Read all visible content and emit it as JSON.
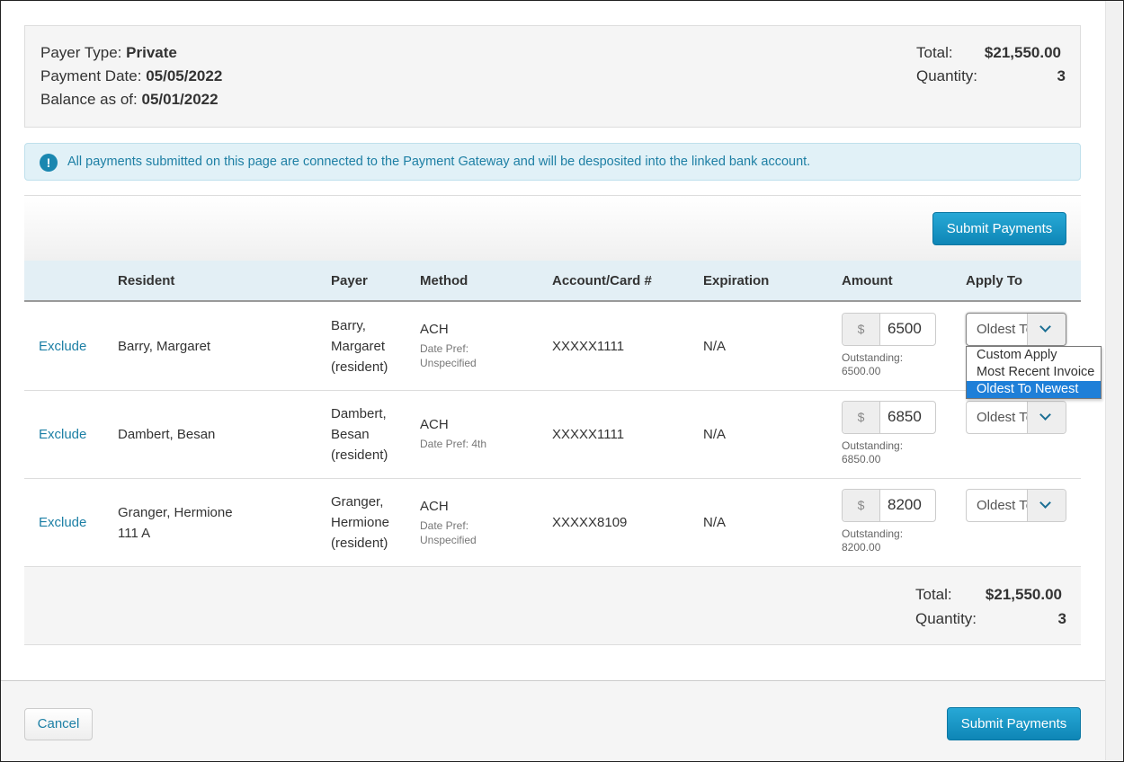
{
  "summary": {
    "payer_type_label": "Payer Type:",
    "payer_type": "Private",
    "payment_date_label": "Payment Date:",
    "payment_date": "05/05/2022",
    "balance_label": "Balance as of:",
    "balance_date": "05/01/2022",
    "total_label": "Total:",
    "total": "$21,550.00",
    "quantity_label": "Quantity:",
    "quantity": "3"
  },
  "alert": {
    "icon": "exclamation-icon",
    "message": "All payments submitted on this page are connected to the Payment Gateway and will be desposited into the linked bank account."
  },
  "toolbar": {
    "submit_label": "Submit Payments"
  },
  "table": {
    "headers": {
      "resident": "Resident",
      "payer": "Payer",
      "method": "Method",
      "account": "Account/Card #",
      "expiration": "Expiration",
      "amount": "Amount",
      "apply_to": "Apply To"
    },
    "rows": [
      {
        "exclude": "Exclude",
        "resident_name": "Barry, Margaret",
        "resident_room": "",
        "payer_line1": "Barry,",
        "payer_line2": "Margaret",
        "payer_line3": "(resident)",
        "method": "ACH",
        "date_pref_label": "Date Pref:",
        "date_pref": "Unspecified",
        "account": "XXXXX1111",
        "expiration": "N/A",
        "currency": "$",
        "amount": "6500",
        "outstanding_label": "Outstanding:",
        "outstanding": "6500.00",
        "apply_to": "Oldest To Newest"
      },
      {
        "exclude": "Exclude",
        "resident_name": "Dambert, Besan",
        "resident_room": "",
        "payer_line1": "Dambert,",
        "payer_line2": "Besan",
        "payer_line3": "(resident)",
        "method": "ACH",
        "date_pref_label": "Date Pref: 4th",
        "date_pref": "",
        "account": "XXXXX1111",
        "expiration": "N/A",
        "currency": "$",
        "amount": "6850",
        "outstanding_label": "Outstanding:",
        "outstanding": "6850.00",
        "apply_to": "Oldest To Newest"
      },
      {
        "exclude": "Exclude",
        "resident_name": "Granger, Hermione",
        "resident_room": "111 A",
        "payer_line1": "Granger,",
        "payer_line2": "Hermione",
        "payer_line3": "(resident)",
        "method": "ACH",
        "date_pref_label": "Date Pref:",
        "date_pref": "Unspecified",
        "account": "XXXXX8109",
        "expiration": "N/A",
        "currency": "$",
        "amount": "8200",
        "outstanding_label": "Outstanding:",
        "outstanding": "8200.00",
        "apply_to": "Oldest To Newest"
      }
    ]
  },
  "dropdown": {
    "options": [
      "Custom Apply",
      "Most Recent Invoice",
      "Oldest To Newest"
    ],
    "selected": "Oldest To Newest"
  },
  "totals": {
    "total_label": "Total:",
    "total": "$21,550.00",
    "quantity_label": "Quantity:",
    "quantity": "3"
  },
  "footer": {
    "cancel_label": "Cancel",
    "submit_label": "Submit Payments"
  },
  "colors": {
    "primary": "#0e86b6",
    "link": "#1c7fa5",
    "alert_bg": "#e1f1f7",
    "selected_option": "#1e7fd8"
  }
}
